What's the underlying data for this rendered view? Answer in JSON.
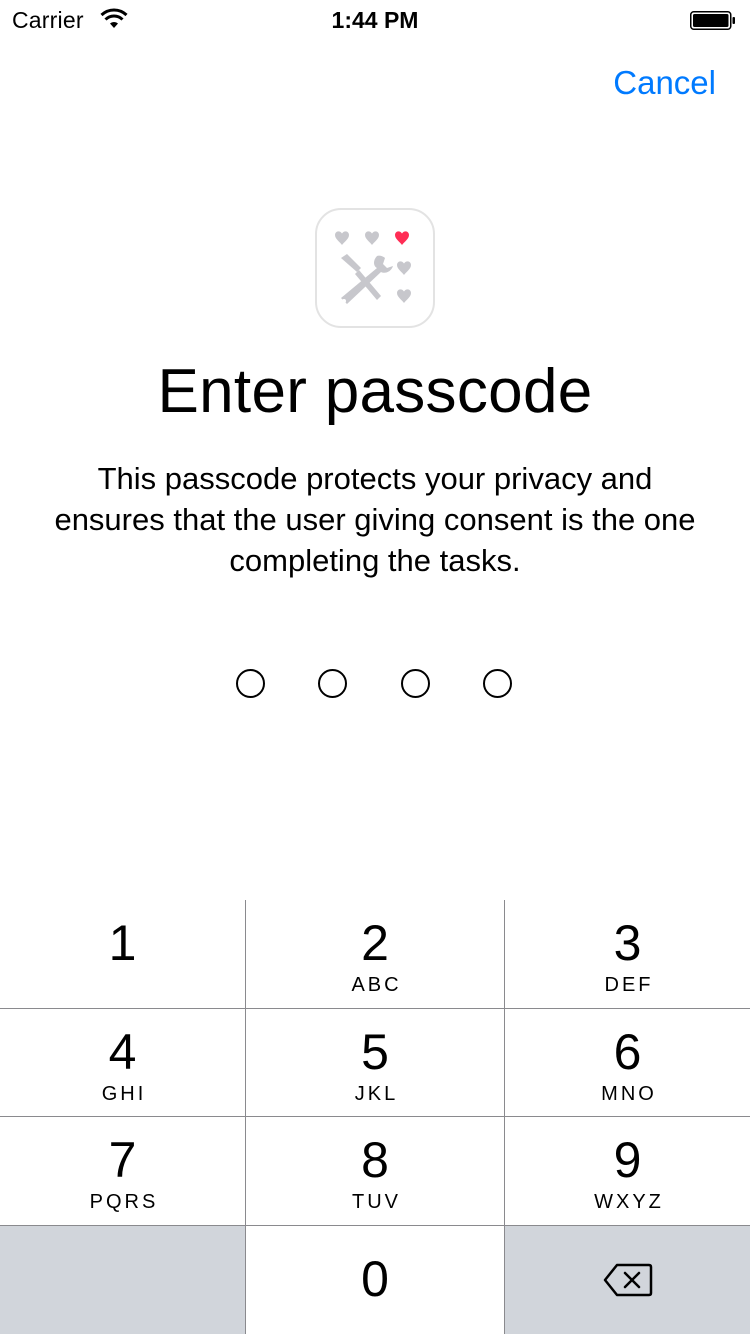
{
  "status_bar": {
    "carrier": "Carrier",
    "time": "1:44 PM",
    "wifi_icon": "wifi-icon",
    "battery_icon": "battery-full-icon"
  },
  "nav": {
    "cancel_label": "Cancel",
    "accent_color": "#007aff"
  },
  "app_icon": {
    "icon": "hearts-and-tools-icon",
    "heart_accent_color": "#ff2d55"
  },
  "title": "Enter passcode",
  "subtitle": "This passcode protects your privacy and ensures that the user giving consent is the one completing the tasks.",
  "passcode": {
    "length": 4,
    "filled": 0
  },
  "keypad": {
    "keys": [
      {
        "digit": "1",
        "letters": ""
      },
      {
        "digit": "2",
        "letters": "ABC"
      },
      {
        "digit": "3",
        "letters": "DEF"
      },
      {
        "digit": "4",
        "letters": "GHI"
      },
      {
        "digit": "5",
        "letters": "JKL"
      },
      {
        "digit": "6",
        "letters": "MNO"
      },
      {
        "digit": "7",
        "letters": "PQRS"
      },
      {
        "digit": "8",
        "letters": "TUV"
      },
      {
        "digit": "9",
        "letters": "WXYZ"
      },
      {
        "digit": "0",
        "letters": ""
      }
    ],
    "delete_icon": "delete-backspace-icon",
    "function_key_color": "#d1d5db"
  }
}
